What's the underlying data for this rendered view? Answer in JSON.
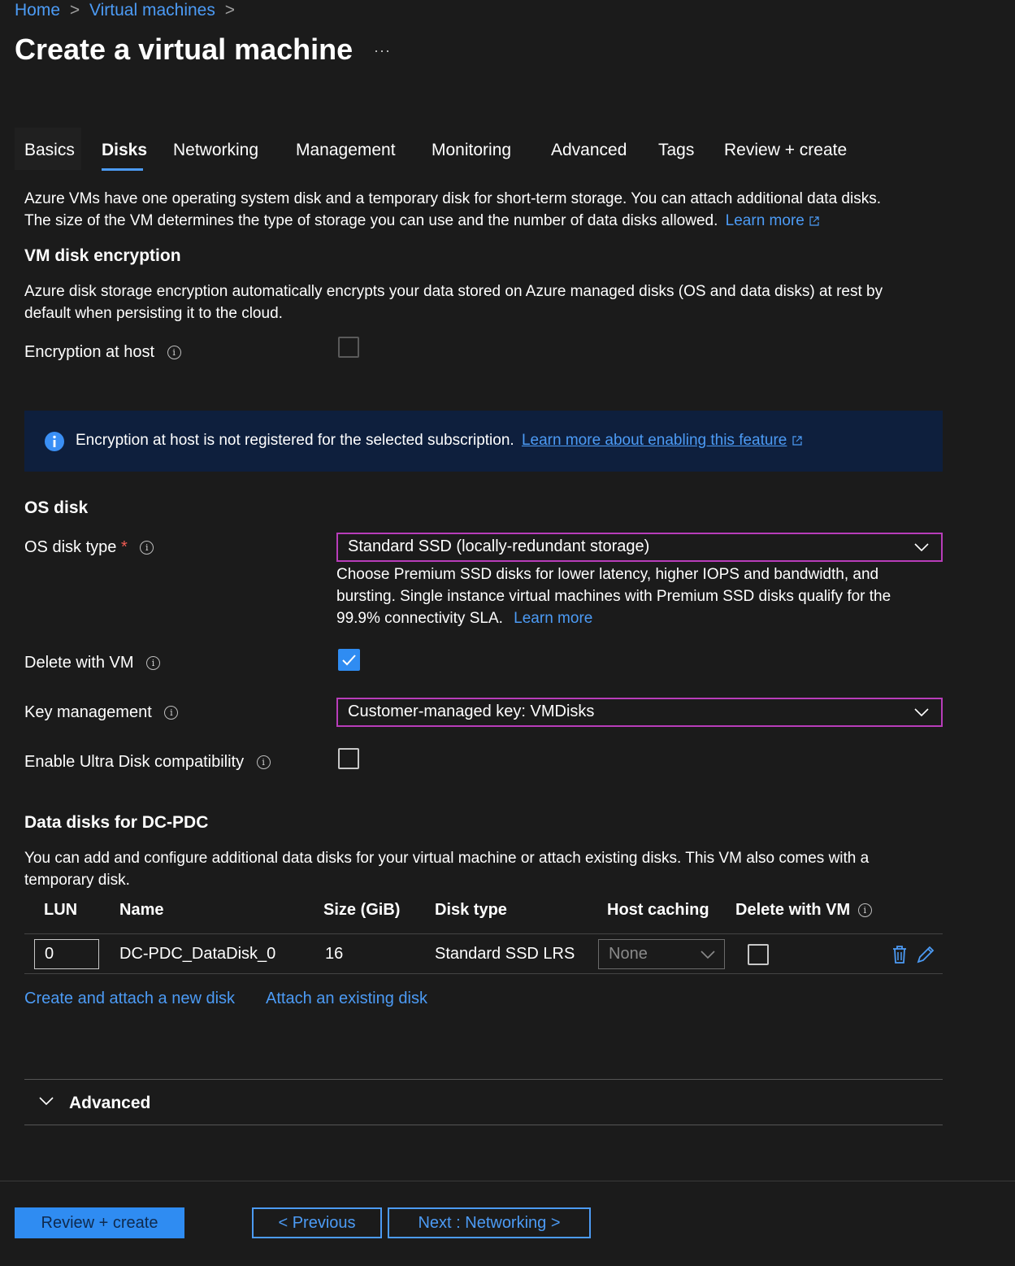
{
  "breadcrumb": {
    "home": "Home",
    "sep": ">",
    "virtual_machines": "Virtual machines"
  },
  "page_title": "Create a virtual machine",
  "more_label": "···",
  "tabs": [
    {
      "label": "Basics"
    },
    {
      "label": "Disks"
    },
    {
      "label": "Networking"
    },
    {
      "label": "Management"
    },
    {
      "label": "Monitoring"
    },
    {
      "label": "Advanced"
    },
    {
      "label": "Tags"
    },
    {
      "label": "Review + create"
    }
  ],
  "intro": {
    "line1": "Azure VMs have one operating system disk and a temporary disk for short-term storage. You can attach additional data disks.",
    "line2": "The size of the VM determines the type of storage you can use and the number of data disks allowed.",
    "learn_more": "Learn more"
  },
  "encryption": {
    "title": "VM disk encryption",
    "desc_line1": "Azure disk storage encryption automatically encrypts your data stored on Azure managed disks (OS and data disks) at rest by",
    "desc_line2": "default when persisting it to the cloud.",
    "host_label": "Encryption at host",
    "banner_text": "Encryption at host is not registered for the selected subscription.",
    "banner_link": "Learn more about enabling this feature"
  },
  "os_disk": {
    "title": "OS disk",
    "type_label": "OS disk type",
    "required_mark": "*",
    "type_value": "Standard SSD (locally-redundant storage)",
    "hint_line1": "Choose Premium SSD disks for lower latency, higher IOPS and bandwidth, and",
    "hint_line2": "bursting. Single instance virtual machines with Premium SSD disks qualify for the",
    "hint_line3": "99.9% connectivity SLA.",
    "hint_link": "Learn more",
    "delete_label": "Delete with VM",
    "delete_checked": true,
    "key_label": "Key management",
    "key_value": "Customer-managed key: VMDisks",
    "ultra_label": "Enable Ultra Disk compatibility"
  },
  "data_disks": {
    "title": "Data disks for DC-PDC",
    "desc_line1": "You can add and configure additional data disks for your virtual machine or attach existing disks. This VM also comes with a",
    "desc_line2": "temporary disk.",
    "columns": {
      "lun": "LUN",
      "name": "Name",
      "size": "Size (GiB)",
      "type": "Disk type",
      "caching": "Host caching",
      "delete": "Delete with VM"
    },
    "rows": [
      {
        "lun": "0",
        "name": "DC-PDC_DataDisk_0",
        "size": "16",
        "type": "Standard SSD LRS",
        "caching": "None"
      }
    ],
    "create_link": "Create and attach a new disk",
    "attach_link": "Attach an existing disk"
  },
  "advanced": {
    "label": "Advanced"
  },
  "footer": {
    "review_label": "Review + create",
    "previous_label": "< Previous",
    "next_label": "Next : Networking >"
  },
  "colors": {
    "background": "#1b1b1b",
    "accent": "#4c9bf5",
    "focus_border": "#b83dba",
    "banner_bg": "#0e1f3d",
    "primary_button": "#2f8cf2",
    "required": "#f25c54"
  },
  "icons": {
    "breadcrumb_separator": "chevron-right-icon",
    "info": "info-icon",
    "external": "external-link-icon",
    "banner": "info-filled-icon",
    "dropdown": "chevron-down-icon",
    "delete_row": "trash-icon",
    "edit_row": "pencil-icon",
    "expand": "chevron-down-icon"
  }
}
